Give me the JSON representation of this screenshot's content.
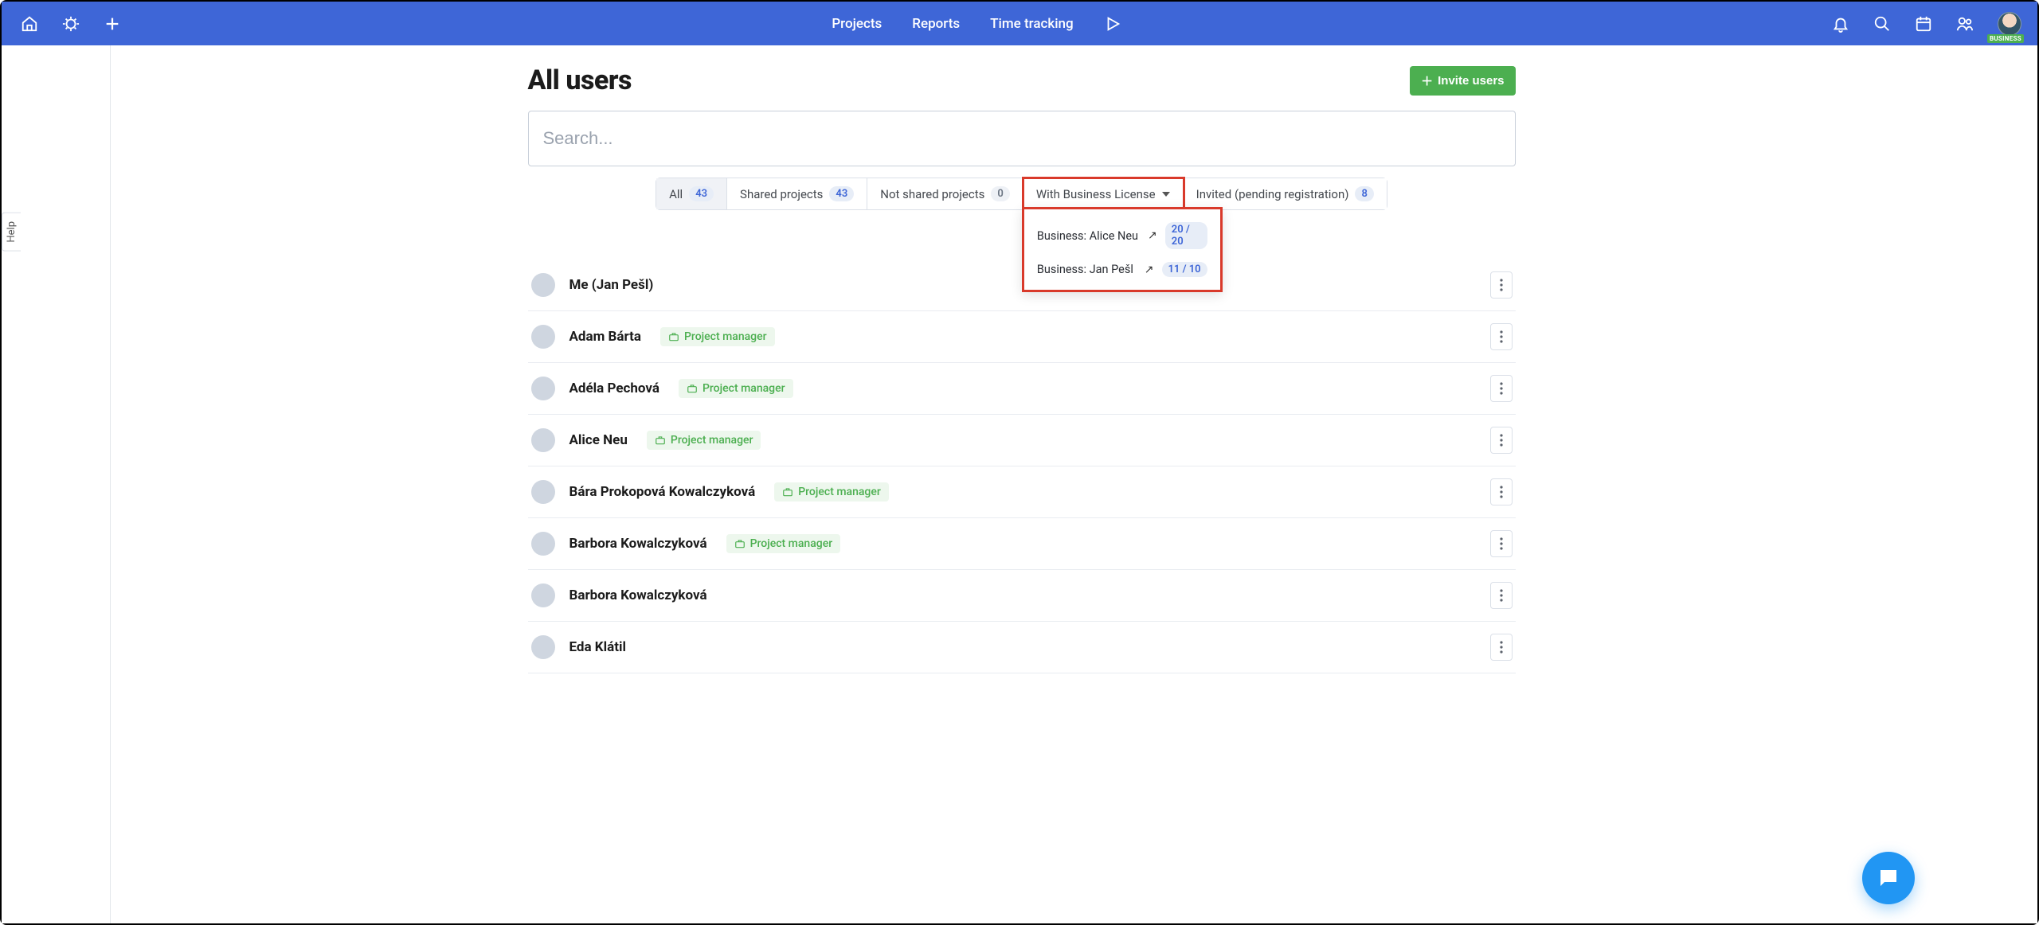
{
  "header": {
    "nav": {
      "projects": "Projects",
      "reports": "Reports",
      "time_tracking": "Time tracking"
    },
    "business_badge": "BUSINESS"
  },
  "sidebar": {
    "help_label": "Help"
  },
  "page": {
    "title": "All users",
    "invite_button": "Invite users",
    "search_placeholder": "Search..."
  },
  "filters": {
    "all": {
      "label": "All",
      "count": "43"
    },
    "shared": {
      "label": "Shared projects",
      "count": "43"
    },
    "not_shared": {
      "label": "Not shared projects",
      "count": "0"
    },
    "with_license": {
      "label": "With Business License"
    },
    "invited": {
      "label": "Invited (pending registration)",
      "count": "8"
    }
  },
  "license_dropdown": {
    "items": [
      {
        "label": "Business: Alice Neu",
        "ratio": "20 / 20"
      },
      {
        "label": "Business: Jan Pešl",
        "ratio": "11 / 10"
      }
    ]
  },
  "role_label": "Project manager",
  "users": [
    {
      "name": "Me (Jan Pešl)",
      "role": false,
      "avatar": "av1"
    },
    {
      "name": "Adam Bárta",
      "role": true,
      "avatar": "av2"
    },
    {
      "name": "Adéla Pechová",
      "role": true,
      "avatar": "av3"
    },
    {
      "name": "Alice Neu",
      "role": true,
      "avatar": "av4"
    },
    {
      "name": "Bára Prokopová Kowalczyková",
      "role": true,
      "avatar": "av5"
    },
    {
      "name": "Barbora Kowalczyková",
      "role": true,
      "avatar": "av6"
    },
    {
      "name": "Barbora Kowalczyková",
      "role": false,
      "avatar": "av7"
    },
    {
      "name": "Eda Klátil",
      "role": false,
      "avatar": "av8"
    }
  ]
}
